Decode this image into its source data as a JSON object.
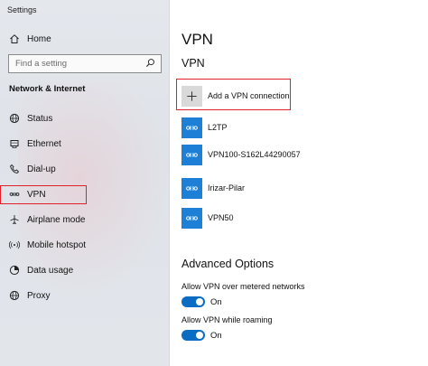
{
  "window": {
    "title": "Settings"
  },
  "sidebar": {
    "home_label": "Home",
    "search_placeholder": "Find a setting",
    "section_label": "Network & Internet",
    "items": [
      {
        "label": "Status",
        "icon": "globe-icon"
      },
      {
        "label": "Ethernet",
        "icon": "ethernet-icon"
      },
      {
        "label": "Dial-up",
        "icon": "phone-icon"
      },
      {
        "label": "VPN",
        "icon": "vpn-icon",
        "selected": true
      },
      {
        "label": "Airplane mode",
        "icon": "airplane-icon"
      },
      {
        "label": "Mobile hotspot",
        "icon": "hotspot-icon"
      },
      {
        "label": "Data usage",
        "icon": "data-usage-icon"
      },
      {
        "label": "Proxy",
        "icon": "proxy-globe-icon"
      }
    ]
  },
  "main": {
    "page_title": "VPN",
    "section_title": "VPN",
    "add_label": "Add a VPN connection",
    "connections": [
      {
        "name": "L2TP"
      },
      {
        "name": "VPN100-S162L44290057"
      },
      {
        "name": "Irizar-Pilar"
      },
      {
        "name": "VPN50"
      }
    ],
    "advanced_title": "Advanced Options",
    "options": [
      {
        "label": "Allow VPN over metered networks",
        "state": "On",
        "on": true
      },
      {
        "label": "Allow VPN while roaming",
        "state": "On",
        "on": true
      }
    ]
  },
  "colors": {
    "accent": "#0a6cc2",
    "tile_blue": "#1e7fd6",
    "highlight_box": "#e0202a"
  }
}
